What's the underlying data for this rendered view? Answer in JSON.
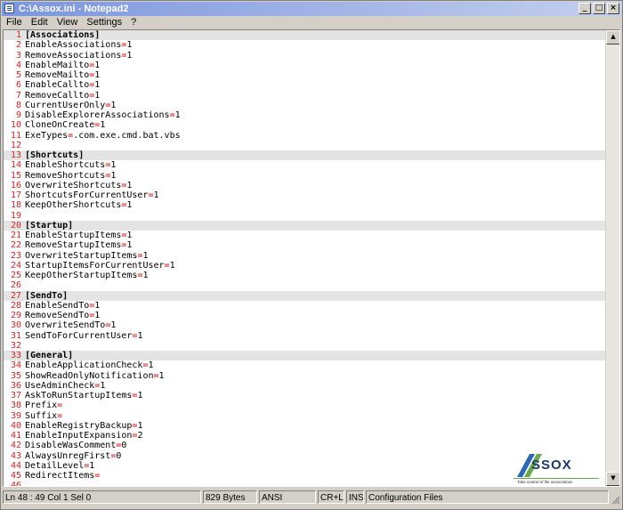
{
  "window": {
    "title": "C:\\Assox.ini - Notepad2",
    "buttons": {
      "minimize": "_",
      "maximize": "□",
      "close": "×"
    }
  },
  "menu": [
    "File",
    "Edit",
    "View",
    "Settings",
    "?"
  ],
  "editor": {
    "lines": [
      {
        "n": "1",
        "key": "[Associations]",
        "section": true
      },
      {
        "n": "2",
        "key": "EnableAssociations",
        "val": "1"
      },
      {
        "n": "3",
        "key": "RemoveAssociations",
        "val": "1"
      },
      {
        "n": "4",
        "key": "EnableMailto",
        "val": "1"
      },
      {
        "n": "5",
        "key": "RemoveMailto",
        "val": "1"
      },
      {
        "n": "6",
        "key": "EnableCallto",
        "val": "1"
      },
      {
        "n": "7",
        "key": "RemoveCallto",
        "val": "1"
      },
      {
        "n": "8",
        "key": "CurrentUserOnly",
        "val": "1"
      },
      {
        "n": "9",
        "key": "DisableExplorerAssociations",
        "val": "1"
      },
      {
        "n": "10",
        "key": "CloneOnCreate",
        "val": "1"
      },
      {
        "n": "11",
        "key": "ExeTypes",
        "val": ".com.exe.cmd.bat.vbs"
      },
      {
        "n": "12",
        "key": ""
      },
      {
        "n": "13",
        "key": "[Shortcuts]",
        "section": true
      },
      {
        "n": "14",
        "key": "EnableShortcuts",
        "val": "1"
      },
      {
        "n": "15",
        "key": "RemoveShortcuts",
        "val": "1"
      },
      {
        "n": "16",
        "key": "OverwriteShortcuts",
        "val": "1"
      },
      {
        "n": "17",
        "key": "ShortcutsForCurrentUser",
        "val": "1"
      },
      {
        "n": "18",
        "key": "KeepOtherShortcuts",
        "val": "1"
      },
      {
        "n": "19",
        "key": ""
      },
      {
        "n": "20",
        "key": "[Startup]",
        "section": true
      },
      {
        "n": "21",
        "key": "EnableStartupItems",
        "val": "1"
      },
      {
        "n": "22",
        "key": "RemoveStartupItems",
        "val": "1"
      },
      {
        "n": "23",
        "key": "OverwriteStartupItems",
        "val": "1"
      },
      {
        "n": "24",
        "key": "StartupItemsForCurrentUser",
        "val": "1"
      },
      {
        "n": "25",
        "key": "KeepOtherStartupItems",
        "val": "1"
      },
      {
        "n": "26",
        "key": ""
      },
      {
        "n": "27",
        "key": "[SendTo]",
        "section": true
      },
      {
        "n": "28",
        "key": "EnableSendTo",
        "val": "1"
      },
      {
        "n": "29",
        "key": "RemoveSendTo",
        "val": "1"
      },
      {
        "n": "30",
        "key": "OverwriteSendTo",
        "val": "1"
      },
      {
        "n": "31",
        "key": "SendToForCurrentUser",
        "val": "1"
      },
      {
        "n": "32",
        "key": ""
      },
      {
        "n": "33",
        "key": "[General]",
        "section": true
      },
      {
        "n": "34",
        "key": "EnableApplicationCheck",
        "val": "1"
      },
      {
        "n": "35",
        "key": "ShowReadOnlyNotification",
        "val": "1"
      },
      {
        "n": "36",
        "key": "UseAdminCheck",
        "val": "1"
      },
      {
        "n": "37",
        "key": "AskToRunStartupItems",
        "val": "1"
      },
      {
        "n": "38",
        "key": "Prefix",
        "val": ""
      },
      {
        "n": "39",
        "key": "Suffix",
        "val": ""
      },
      {
        "n": "40",
        "key": "EnableRegistryBackup",
        "val": "1"
      },
      {
        "n": "41",
        "key": "EnableInputExpansion",
        "val": "2"
      },
      {
        "n": "42",
        "key": "DisableWasComment",
        "val": "0"
      },
      {
        "n": "43",
        "key": "AlwaysUnregFirst",
        "val": "0"
      },
      {
        "n": "44",
        "key": "DetailLevel",
        "val": "1"
      },
      {
        "n": "45",
        "key": "RedirectItems",
        "val": ""
      },
      {
        "n": "46",
        "key": ""
      }
    ]
  },
  "logo": {
    "text": "ASSOX",
    "tagline": "Take control of file associations"
  },
  "status": {
    "position": "Ln 48 : 49   Col 1   Sel 0",
    "size": "829 Bytes",
    "encoding": "ANSI",
    "eol": "CR+LF",
    "mode": "INS",
    "lexer": "Configuration Files"
  },
  "colors": {
    "line_numbers": "#dd2222",
    "section_bg": "#e4e4e4",
    "equals": "#cc0000"
  }
}
